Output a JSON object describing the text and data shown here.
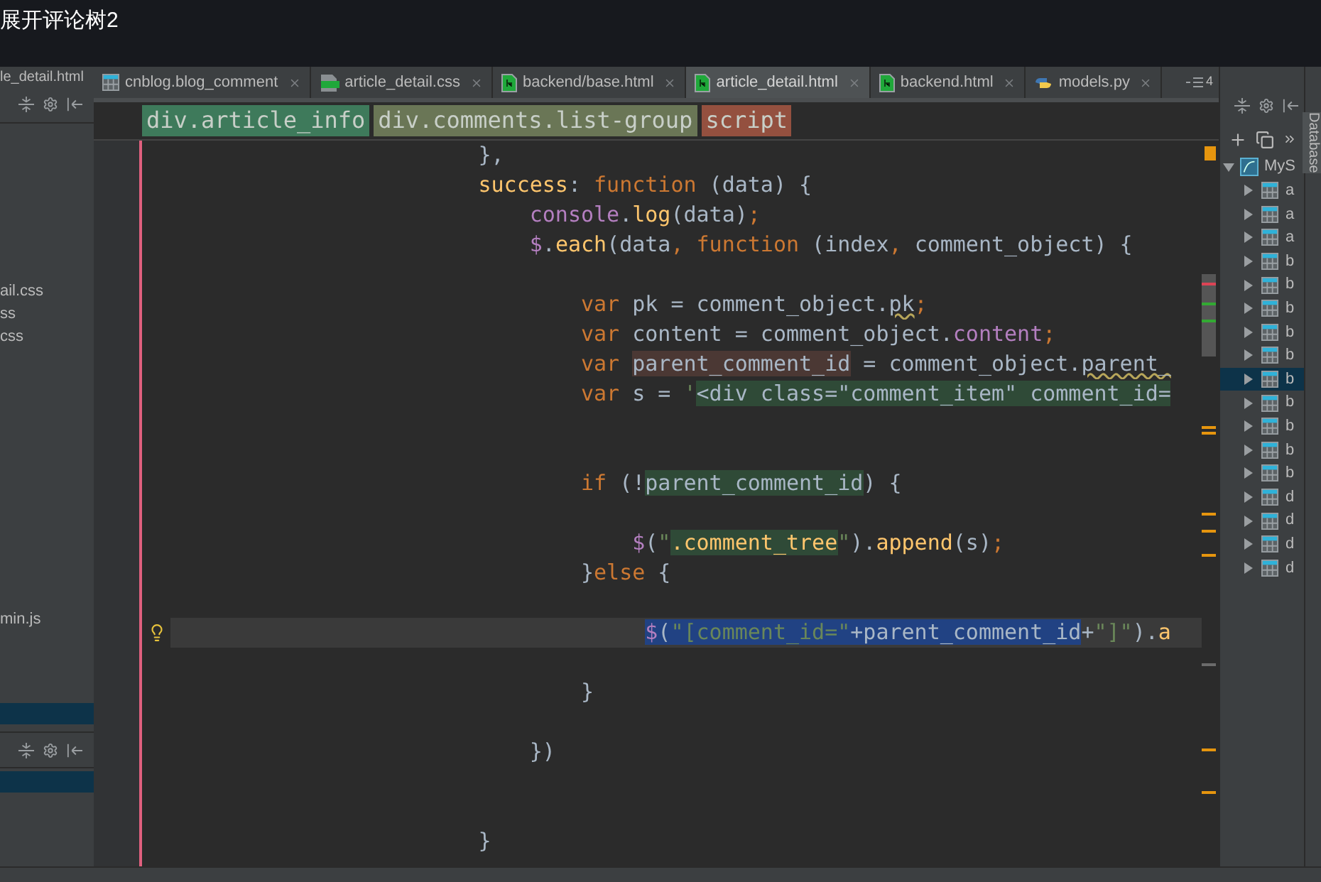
{
  "window": {
    "title": "展开评论树2"
  },
  "project_panel": {
    "header": "le_detail.html",
    "items": [
      {
        "label": "ail.css"
      },
      {
        "label": "ss"
      },
      {
        "label": "css"
      },
      {
        "label": "min.js"
      }
    ]
  },
  "tabs": [
    {
      "label": "cnblog.blog_comment",
      "kind": "table",
      "selected": false
    },
    {
      "label": "article_detail.css",
      "kind": "css",
      "selected": false
    },
    {
      "label": "backend/base.html",
      "kind": "html",
      "selected": false
    },
    {
      "label": "article_detail.html",
      "kind": "html",
      "selected": true
    },
    {
      "label": "backend.html",
      "kind": "html",
      "selected": false
    },
    {
      "label": "models.py",
      "kind": "python",
      "selected": false
    }
  ],
  "tabs_overflow": "4",
  "breadcrumbs": [
    {
      "label": "div.article_info",
      "color": "#3e7a5b"
    },
    {
      "label": "div.comments.list-group",
      "color": "#6a7656"
    },
    {
      "label": "script",
      "color": "#94503f"
    }
  ],
  "code": [
    {
      "current": false,
      "tokens": [
        {
          "t": "                        },",
          "kind": "plain"
        }
      ]
    },
    {
      "current": false,
      "tokens": [
        {
          "t": "                        success",
          "kind": "fn"
        },
        {
          "t": ": ",
          "kind": "plain"
        },
        {
          "t": "function",
          "kind": "kw"
        },
        {
          "t": " (data) {",
          "kind": "plain"
        }
      ]
    },
    {
      "current": false,
      "tokens": [
        {
          "t": "                            console",
          "kind": "field"
        },
        {
          "t": ".",
          "kind": "plain"
        },
        {
          "t": "log",
          "kind": "fn"
        },
        {
          "t": "(data)",
          "kind": "plain"
        },
        {
          "t": ";",
          "kind": "kw"
        }
      ]
    },
    {
      "current": false,
      "tokens": [
        {
          "t": "                            $",
          "kind": "field"
        },
        {
          "t": ".",
          "kind": "plain"
        },
        {
          "t": "each",
          "kind": "fn"
        },
        {
          "t": "(data",
          "kind": "plain"
        },
        {
          "t": ", ",
          "kind": "kw"
        },
        {
          "t": "function",
          "kind": "kw"
        },
        {
          "t": " (index",
          "kind": "plain"
        },
        {
          "t": ", ",
          "kind": "kw"
        },
        {
          "t": "comment_object) {",
          "kind": "plain"
        }
      ]
    },
    {
      "current": false
    },
    {
      "current": false,
      "tokens": [
        {
          "t": "                                var",
          "kind": "kw"
        },
        {
          "t": " pk = comment_object.",
          "kind": "plain"
        },
        {
          "kind": "warning",
          "tokens": [
            {
              "t": "pk",
              "kind": "plain"
            }
          ]
        },
        {
          "t": ";",
          "kind": "kw"
        }
      ]
    },
    {
      "current": false,
      "tokens": [
        {
          "t": "                                var",
          "kind": "kw"
        },
        {
          "t": " content = comment_object.",
          "kind": "plain"
        },
        {
          "t": "content",
          "kind": "field"
        },
        {
          "t": ";",
          "kind": "kw"
        }
      ]
    },
    {
      "current": false,
      "tokens": [
        {
          "t": "                                var ",
          "kind": "kw"
        },
        {
          "kind": "write_usage",
          "tokens": [
            {
              "t": "parent_comment_id",
              "kind": "plain"
            }
          ]
        },
        {
          "t": " = comment_object.",
          "kind": "plain"
        },
        {
          "kind": "warning",
          "tokens": [
            {
              "t": "parent_",
              "kind": "plain"
            }
          ]
        }
      ]
    },
    {
      "current": false,
      "tokens": [
        {
          "t": "                                var",
          "kind": "kw"
        },
        {
          "t": " s = ",
          "kind": "plain"
        },
        {
          "t": "'",
          "kind": "str"
        },
        {
          "kind": "injection",
          "tokens": [
            {
              "t": "<div class=\"comment_item\" comment_id=",
              "kind": "plain"
            }
          ]
        }
      ]
    },
    {
      "current": false
    },
    {
      "current": false
    },
    {
      "current": false,
      "tokens": [
        {
          "t": "                                if",
          "kind": "kw"
        },
        {
          "t": " (!",
          "kind": "plain"
        },
        {
          "kind": "read_usage",
          "tokens": [
            {
              "t": "parent_comment_id",
              "kind": "plain"
            }
          ]
        },
        {
          "t": ") {",
          "kind": "plain"
        }
      ]
    },
    {
      "current": false
    },
    {
      "current": false,
      "tokens": [
        {
          "t": "                                    $",
          "kind": "field"
        },
        {
          "t": "(",
          "kind": "plain"
        },
        {
          "t": "\"",
          "kind": "str"
        },
        {
          "kind": "injection",
          "tokens": [
            {
              "t": ".comment_tree",
              "kind": "fn"
            }
          ]
        },
        {
          "t": "\"",
          "kind": "str"
        },
        {
          "t": ").",
          "kind": "plain"
        },
        {
          "t": "append",
          "kind": "fn"
        },
        {
          "t": "(s)",
          "kind": "plain"
        },
        {
          "t": ";",
          "kind": "kw"
        }
      ]
    },
    {
      "current": false,
      "tokens": [
        {
          "t": "                                }",
          "kind": "plain"
        },
        {
          "t": "else",
          "kind": "kw"
        },
        {
          "t": " {",
          "kind": "plain"
        }
      ]
    },
    {
      "current": false
    },
    {
      "current": true,
      "bulb": true,
      "tokens": [
        {
          "kind": "selection",
          "tokens": [
            {
              "t": "                                     $",
              "kind": "field"
            },
            {
              "t": "(",
              "kind": "plain"
            },
            {
              "t": "\"[comment_id=\"",
              "kind": "str"
            },
            {
              "t": "+parent_comment_id",
              "kind": "plain"
            }
          ]
        },
        {
          "t": "+",
          "kind": "plain"
        },
        {
          "t": "\"]\"",
          "kind": "str"
        },
        {
          "t": ").",
          "kind": "plain"
        },
        {
          "t": "a",
          "kind": "fn"
        }
      ]
    },
    {
      "current": false
    },
    {
      "current": false,
      "tokens": [
        {
          "t": "                                }",
          "kind": "plain"
        }
      ]
    },
    {
      "current": false
    },
    {
      "current": false,
      "tokens": [
        {
          "t": "                            })",
          "kind": "plain"
        }
      ]
    },
    {
      "current": false
    },
    {
      "current": false
    },
    {
      "current": false,
      "tokens": [
        {
          "t": "                        }",
          "kind": "plain"
        }
      ]
    }
  ],
  "database_panel": {
    "label": "Database",
    "root": {
      "label": "MyS",
      "expanded": true,
      "children": [
        {
          "label": "a",
          "selected": false
        },
        {
          "label": "a",
          "selected": false
        },
        {
          "label": "a",
          "selected": false
        },
        {
          "label": "b",
          "selected": false
        },
        {
          "label": "b",
          "selected": false
        },
        {
          "label": "b",
          "selected": false
        },
        {
          "label": "b",
          "selected": false
        },
        {
          "label": "b",
          "selected": false
        },
        {
          "label": "b",
          "selected": true
        },
        {
          "label": "b",
          "selected": false
        },
        {
          "label": "b",
          "selected": false
        },
        {
          "label": "b",
          "selected": false
        },
        {
          "label": "b",
          "selected": false
        },
        {
          "label": "d",
          "selected": false
        },
        {
          "label": "d",
          "selected": false
        },
        {
          "label": "d",
          "selected": false
        },
        {
          "label": "d",
          "selected": false
        }
      ]
    }
  }
}
